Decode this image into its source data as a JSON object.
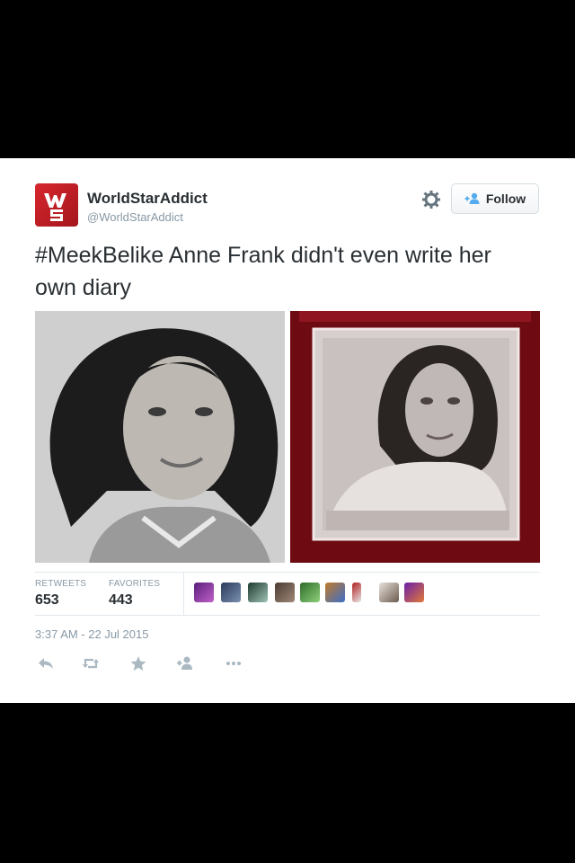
{
  "tweet": {
    "author_name": "WorldStarAddict",
    "author_handle": "@WorldStarAddict",
    "text": "#MeekBelike Anne Frank didn't even write her own diary",
    "follow_label": "Follow",
    "retweets_label": "RETWEETS",
    "retweets_count": "653",
    "favorites_label": "FAVORITES",
    "favorites_count": "443",
    "timestamp": "3:37 AM - 22 Jul 2015"
  },
  "icons": {
    "avatar": "worldstar-logo-icon",
    "gear": "gear-icon",
    "follow": "add-user-icon",
    "reply": "reply-icon",
    "retweet": "retweet-icon",
    "favorite": "star-icon",
    "follow_action": "add-user-icon",
    "more": "more-icon"
  },
  "colors": {
    "accent": "#55acee",
    "brand_red": "#d8262e",
    "text_primary": "#292f33",
    "text_secondary": "#8899a6"
  }
}
